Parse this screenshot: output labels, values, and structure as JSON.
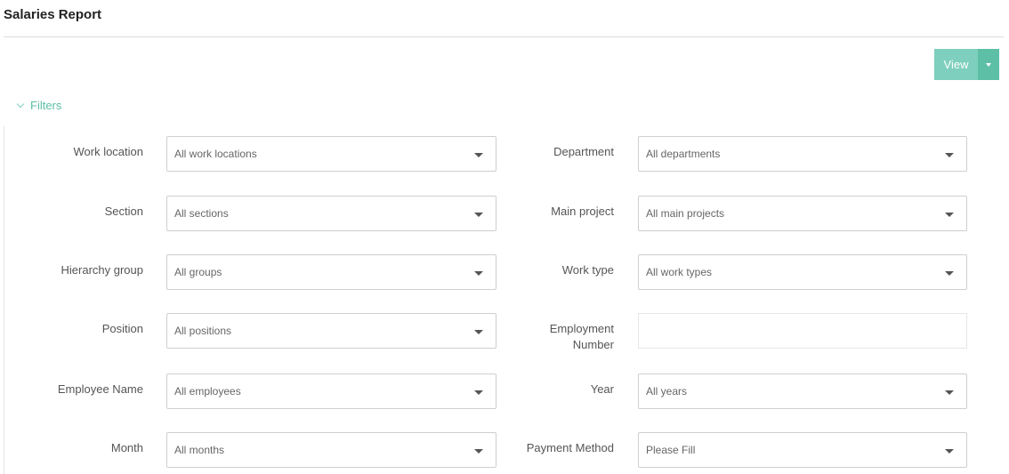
{
  "page": {
    "title": "Salaries Report"
  },
  "toolbar": {
    "view_label": "View"
  },
  "filters": {
    "toggle_label": "Filters",
    "fields": {
      "work_location": {
        "label": "Work location",
        "value": "All work locations"
      },
      "department": {
        "label": "Department",
        "value": "All departments"
      },
      "section": {
        "label": "Section",
        "value": "All sections"
      },
      "main_project": {
        "label": "Main project",
        "value": "All main projects"
      },
      "hierarchy_group": {
        "label": "Hierarchy group",
        "value": "All groups"
      },
      "work_type": {
        "label": "Work type",
        "value": "All work types"
      },
      "position": {
        "label": "Position",
        "value": "All positions"
      },
      "employment_number": {
        "label_line1": "Employment",
        "label_line2": "Number",
        "value": ""
      },
      "employee_name": {
        "label": "Employee Name",
        "value": "All employees"
      },
      "year": {
        "label": "Year",
        "value": "All years"
      },
      "month": {
        "label": "Month",
        "value": "All months"
      },
      "payment_method": {
        "label": "Payment Method",
        "value": "Please Fill"
      }
    }
  },
  "colors": {
    "accent": "#5cbfa6",
    "accent_light": "#7ecfbe"
  }
}
